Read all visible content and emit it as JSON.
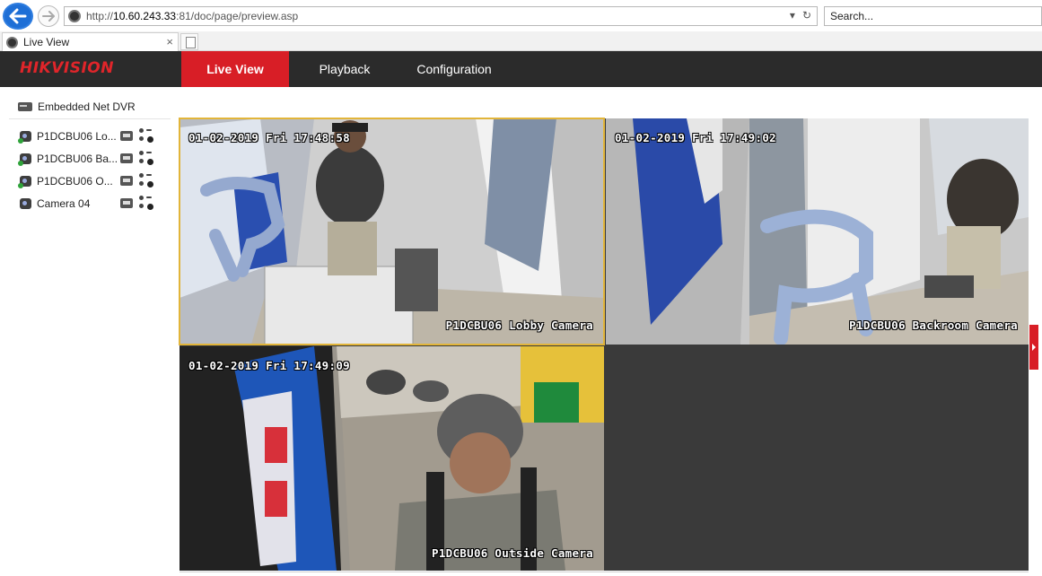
{
  "browser": {
    "url_prefix": "http://",
    "url_host": "10.60.243.33",
    "url_rest": ":81/doc/page/preview.asp",
    "search_placeholder": "Search...",
    "tab_title": "Live View"
  },
  "header": {
    "logo_red": "HIK",
    "logo_grey": "VISION",
    "menu": [
      {
        "label": "Live View",
        "active": true
      },
      {
        "label": "Playback",
        "active": false
      },
      {
        "label": "Configuration",
        "active": false
      }
    ]
  },
  "sidebar": {
    "device": "Embedded Net DVR",
    "cameras": [
      {
        "label": "P1DCBU06 Lo..."
      },
      {
        "label": "P1DCBU06 Ba..."
      },
      {
        "label": "P1DCBU06 O..."
      },
      {
        "label": "Camera 04"
      }
    ]
  },
  "tiles": [
    {
      "timestamp": "01-02-2019 Fri 17:48:58",
      "camera_name": "P1DCBU06 Lobby Camera"
    },
    {
      "timestamp": "01-02-2019 Fri 17:49:02",
      "camera_name": "P1DCBU06 Backroom Camera"
    },
    {
      "timestamp": "01-02-2019 Fri 17:49:09",
      "camera_name": "P1DCBU06 Outside Camera"
    },
    {
      "timestamp": "",
      "camera_name": ""
    }
  ],
  "colors": {
    "brand_red": "#d81e26",
    "header_bg": "#2b2b2b",
    "selected_outline": "#e2b53a"
  }
}
